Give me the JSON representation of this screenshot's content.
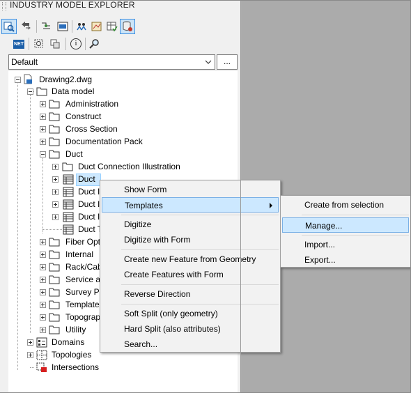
{
  "palette": {
    "title": "INDUSTRY MODEL EXPLORER"
  },
  "toolbar_row1": [
    {
      "icon": "explorer-view-icon",
      "active": true
    },
    {
      "icon": "back-arrow-icon",
      "active": false
    },
    {
      "icon": "filter-icon",
      "active": false
    },
    {
      "icon": "form-view-icon",
      "active": false
    },
    {
      "icon": "users-icon",
      "active": false
    },
    {
      "icon": "export-map-icon",
      "active": false
    },
    {
      "icon": "table-check-icon",
      "active": false
    },
    {
      "icon": "database-icon",
      "active": true
    }
  ],
  "toolbar_row2": [
    {
      "icon": "dotnet-icon"
    },
    {
      "icon": "select-object-icon"
    },
    {
      "icon": "copy-icon"
    },
    {
      "icon": "info-icon"
    },
    {
      "icon": "zoom-icon"
    }
  ],
  "dotnet_label": "NET",
  "info_glyph": "i",
  "combo": {
    "value": "Default",
    "browse_label": "..."
  },
  "tree": {
    "root": "Drawing2.dwg",
    "data_model": "Data model",
    "items": [
      "Administration",
      "Construct",
      "Cross Section",
      "Documentation Pack",
      "Duct"
    ],
    "duct_children": [
      "Duct Connection Illustration",
      "Duct",
      "Duct I",
      "Duct I",
      "Duct I",
      "Duct T"
    ],
    "more_items": [
      "Fiber Opt",
      "Internal",
      "Rack/Cab",
      "Service ac",
      "Survey Pl",
      "Template",
      "Topograp",
      "Utility"
    ],
    "domains": "Domains",
    "topologies": "Topologies",
    "intersections": "Intersections"
  },
  "context_menu": [
    {
      "label": "Show Form",
      "group": 1
    },
    {
      "label": "Templates",
      "group": 1,
      "submenu": true
    },
    {
      "label": "Digitize",
      "group": 2
    },
    {
      "label": "Digitize with Form",
      "group": 2
    },
    {
      "label": "Create new Feature from Geometry",
      "group": 3
    },
    {
      "label": "Create Features with Form",
      "group": 3
    },
    {
      "label": "Reverse Direction",
      "group": 4
    },
    {
      "label": "Soft Split (only geometry)",
      "group": 5
    },
    {
      "label": "Hard Split (also attributes)",
      "group": 5
    },
    {
      "label": "Search...",
      "group": 5
    }
  ],
  "submenu": [
    {
      "label": "Create from selection"
    },
    {
      "label": "Manage..."
    },
    {
      "label": "Import..."
    },
    {
      "label": "Export..."
    }
  ],
  "colors": {
    "highlight": "#cce8ff",
    "highlight_border": "#7ab0e6",
    "folder": "#ffffff",
    "right_pane": "#ababab"
  }
}
